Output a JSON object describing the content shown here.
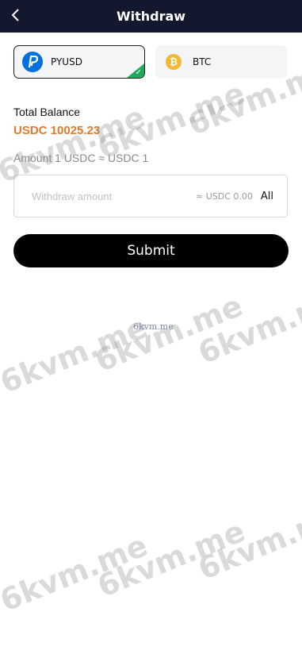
{
  "header": {
    "title": "Withdraw"
  },
  "tabs": [
    {
      "label": "PYUSD",
      "selected": true,
      "icon": "paypal-icon",
      "color": "#0070e0"
    },
    {
      "label": "BTC",
      "selected": false,
      "icon": "bitcoin-icon",
      "color": "#f2b936"
    }
  ],
  "balance": {
    "label": "Total Balance",
    "value": "USDC 10025.23",
    "color": "#e27a2c"
  },
  "rate": "Amount 1 USDC ≈ USDC 1",
  "amount": {
    "placeholder": "Withdraw amount",
    "approx": "≈ USDC  0.00",
    "all_label": "All"
  },
  "submit_label": "Submit",
  "watermark": {
    "text": "6kvm.me",
    "small_text": "6kvm.me"
  }
}
